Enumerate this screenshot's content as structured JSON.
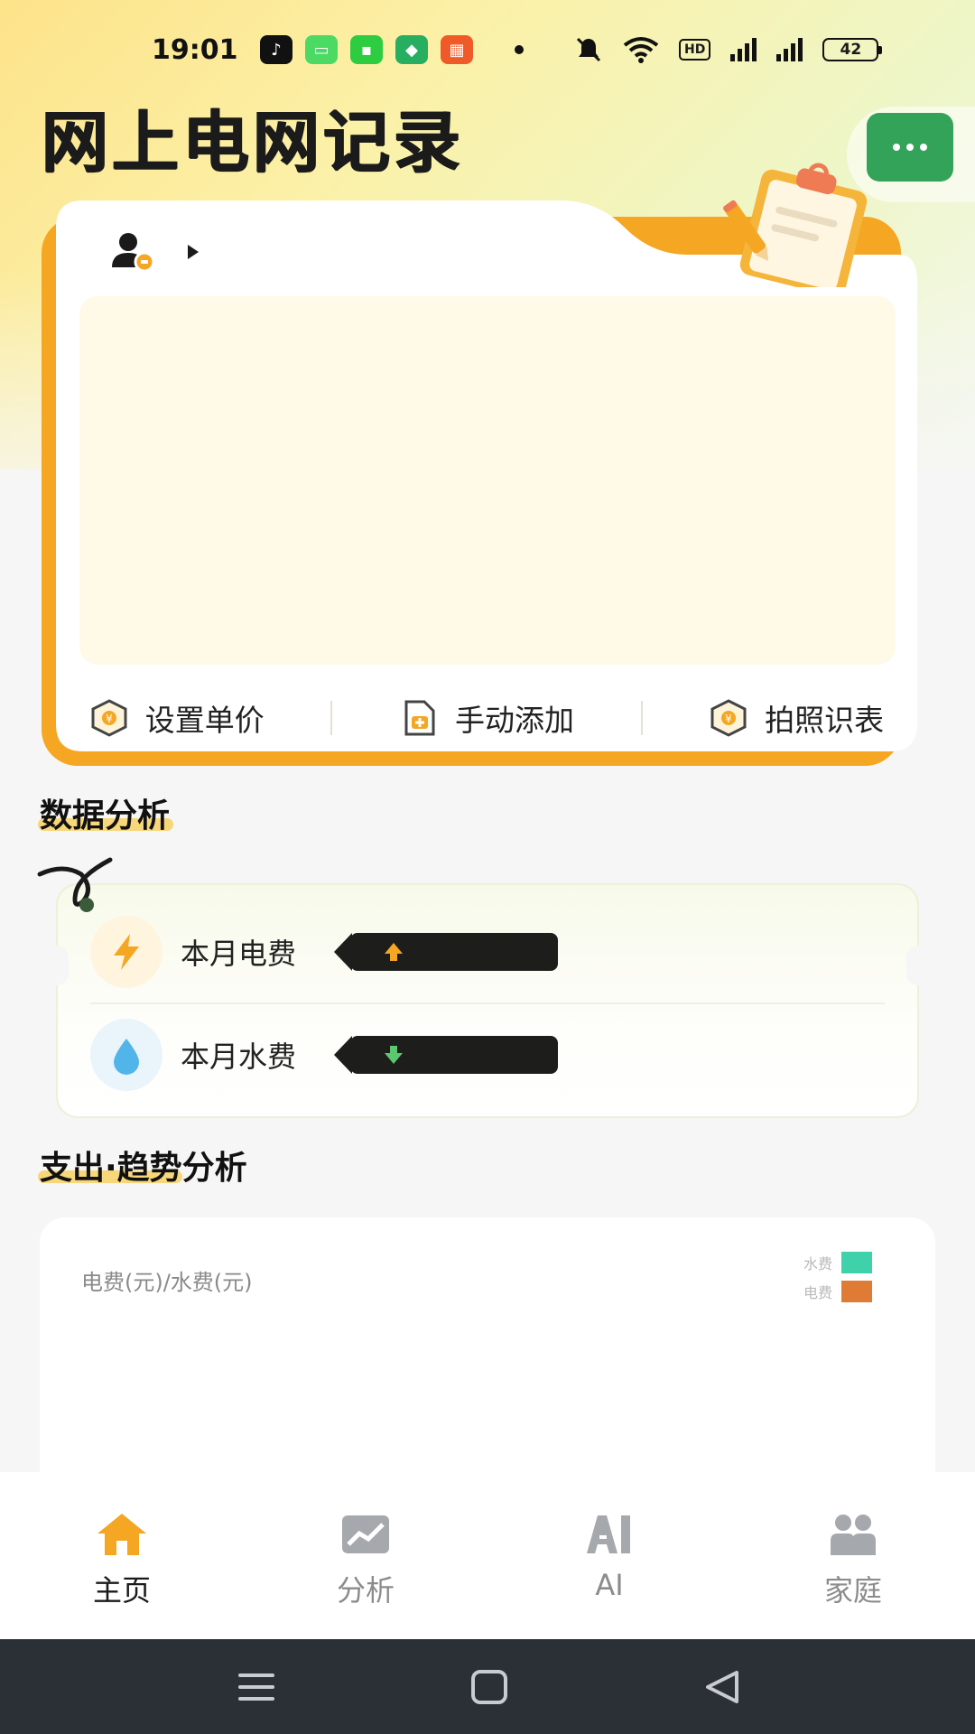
{
  "status_bar": {
    "time": "19:01",
    "battery": "42",
    "hd": "HD"
  },
  "app": {
    "title": "网上电网记录"
  },
  "card": {
    "actions": [
      {
        "label": "设置单价",
        "icon": "coin-shield-icon"
      },
      {
        "label": "手动添加",
        "icon": "add-document-icon"
      },
      {
        "label": "拍照识表",
        "icon": "coin-shield-icon"
      }
    ]
  },
  "analysis": {
    "title": "数据分析",
    "electricity_label": "本月电费",
    "water_label": "本月水费",
    "electricity_trend": "up-arrow-icon",
    "water_trend": "down-arrow-icon"
  },
  "trend": {
    "title": "支出·趋势分析",
    "y_label": "电费(元)/水费(元)",
    "legend": [
      {
        "name": "水费",
        "color": "#3fd1a9"
      },
      {
        "name": "电费",
        "color": "#e07b35"
      }
    ]
  },
  "nav": {
    "items": [
      {
        "label": "主页",
        "icon": "home-icon",
        "active": true
      },
      {
        "label": "分析",
        "icon": "chart-icon",
        "active": false
      },
      {
        "label": "AI",
        "icon": "ai-icon",
        "active": false
      },
      {
        "label": "家庭",
        "icon": "family-icon",
        "active": false
      }
    ]
  },
  "colors": {
    "accent_orange": "#f5a623",
    "accent_green": "#34a35a",
    "water_color": "#3fd1a9",
    "electricity_color": "#e07b35"
  }
}
